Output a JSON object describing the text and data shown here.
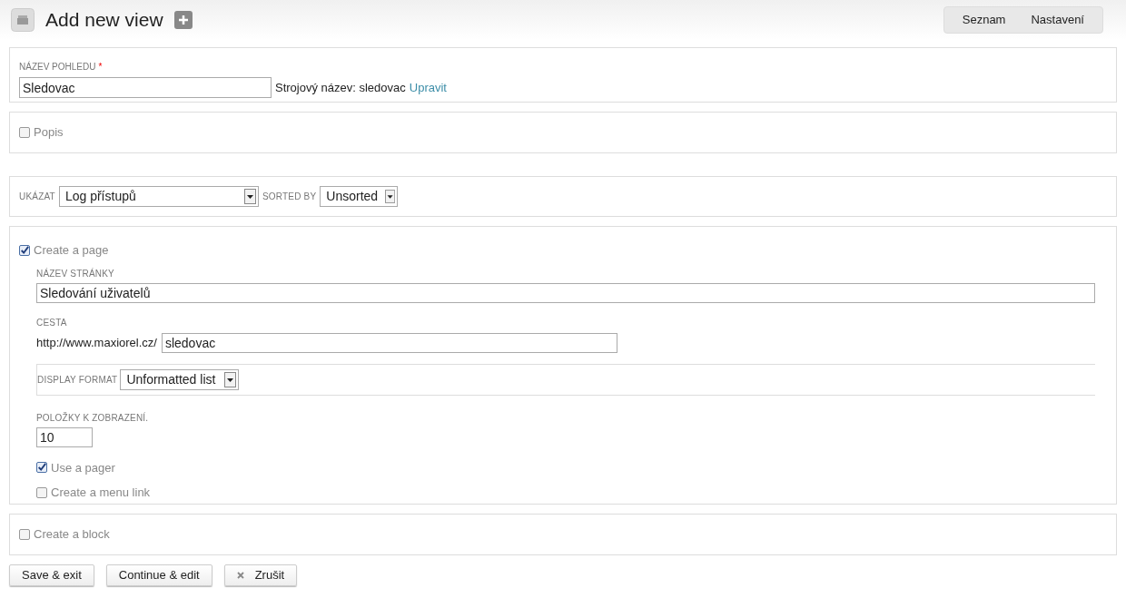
{
  "header": {
    "title": "Add new view",
    "tabs": [
      {
        "label": "Seznam",
        "selected": false
      },
      {
        "label": "Nastavení",
        "selected": false
      }
    ]
  },
  "name_section": {
    "label": "NÁZEV POHLEDU",
    "required_mark": "*",
    "value": "Sledovac",
    "machine_name": "Strojový název: sledovac",
    "edit_link": "Upravit"
  },
  "description": {
    "label": "Popis",
    "checked": false
  },
  "show_section": {
    "show_label": "UKÁZAT",
    "show_value": "Log přístupů",
    "sort_label": "SORTED BY",
    "sort_value": "Unsorted"
  },
  "page_section": {
    "label": "Create a page",
    "checked": true,
    "title_label": "NÁZEV STRÁNKY",
    "title_value": "Sledování uživatelů",
    "path_label": "CESTA",
    "path_prefix": "http://www.maxiorel.cz/",
    "path_value": "sledovac",
    "format_label": "DISPLAY FORMAT",
    "format_value": "Unformatted list",
    "items_label": "POLOŽKY K ZOBRAZENÍ.",
    "items_value": "10",
    "options": [
      {
        "label": "Use a pager",
        "checked": true
      },
      {
        "label": "Create a menu link",
        "checked": false
      }
    ]
  },
  "block_section": {
    "label": "Create a block",
    "checked": false
  },
  "buttons": [
    {
      "label": "Save & exit",
      "kind": "plain"
    },
    {
      "label": "Continue & edit",
      "kind": "plain"
    },
    {
      "label": "Zrušit",
      "kind": "cancel"
    }
  ]
}
